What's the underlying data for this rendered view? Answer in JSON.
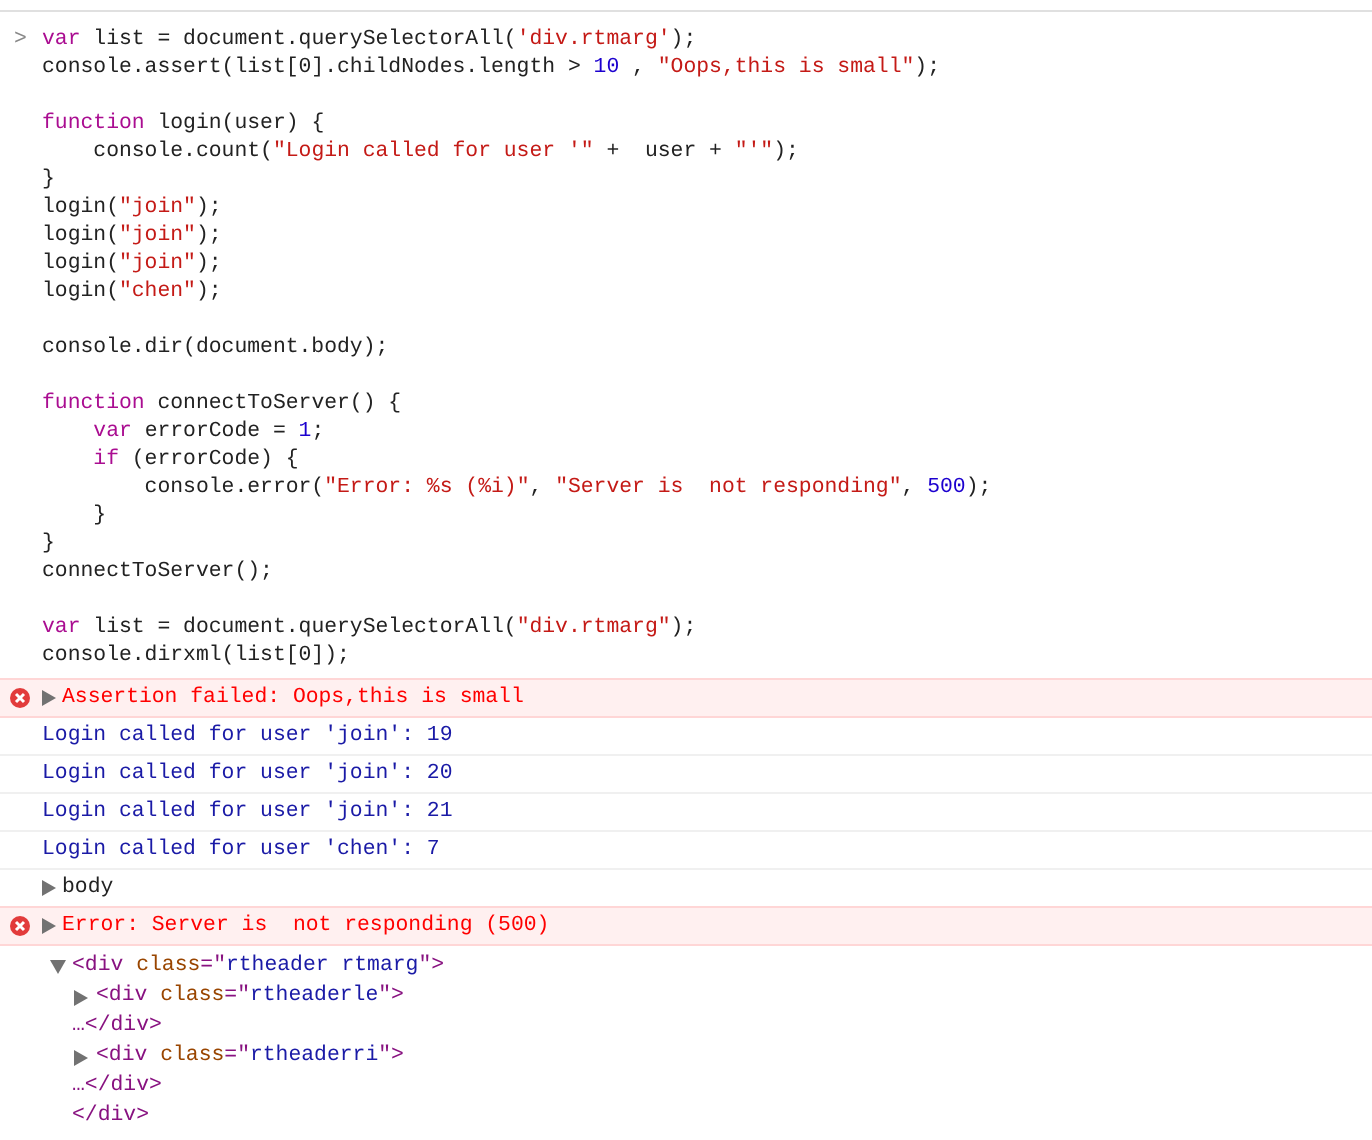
{
  "input": {
    "prompt": ">",
    "lines": [
      {
        "kind": "code",
        "tokens": [
          {
            "kind": "kw",
            "text": "var"
          },
          {
            "kind": "plain",
            "text": " list = document.querySelectorAll("
          },
          {
            "kind": "str",
            "text": "'div.rtmarg'"
          },
          {
            "kind": "plain",
            "text": ");"
          }
        ]
      },
      {
        "kind": "code",
        "tokens": [
          {
            "kind": "plain",
            "text": "console.assert(list[0].childNodes.length > "
          },
          {
            "kind": "num",
            "text": "10"
          },
          {
            "kind": "plain",
            "text": " , "
          },
          {
            "kind": "str",
            "text": "\"Oops,this is small\""
          },
          {
            "kind": "plain",
            "text": ");"
          }
        ]
      },
      {
        "kind": "blank"
      },
      {
        "kind": "code",
        "tokens": [
          {
            "kind": "kw",
            "text": "function"
          },
          {
            "kind": "plain",
            "text": " login(user) {"
          }
        ]
      },
      {
        "kind": "code",
        "tokens": [
          {
            "kind": "plain",
            "text": "    console.count("
          },
          {
            "kind": "str",
            "text": "\"Login called for user '\""
          },
          {
            "kind": "plain",
            "text": " +  user + "
          },
          {
            "kind": "str",
            "text": "\"'\""
          },
          {
            "kind": "plain",
            "text": ");"
          }
        ]
      },
      {
        "kind": "code",
        "tokens": [
          {
            "kind": "plain",
            "text": "}"
          }
        ]
      },
      {
        "kind": "code",
        "tokens": [
          {
            "kind": "plain",
            "text": "login("
          },
          {
            "kind": "str",
            "text": "\"join\""
          },
          {
            "kind": "plain",
            "text": ");"
          }
        ]
      },
      {
        "kind": "code",
        "tokens": [
          {
            "kind": "plain",
            "text": "login("
          },
          {
            "kind": "str",
            "text": "\"join\""
          },
          {
            "kind": "plain",
            "text": ");"
          }
        ]
      },
      {
        "kind": "code",
        "tokens": [
          {
            "kind": "plain",
            "text": "login("
          },
          {
            "kind": "str",
            "text": "\"join\""
          },
          {
            "kind": "plain",
            "text": ");"
          }
        ]
      },
      {
        "kind": "code",
        "tokens": [
          {
            "kind": "plain",
            "text": "login("
          },
          {
            "kind": "str",
            "text": "\"chen\""
          },
          {
            "kind": "plain",
            "text": ");"
          }
        ]
      },
      {
        "kind": "blank"
      },
      {
        "kind": "code",
        "tokens": [
          {
            "kind": "plain",
            "text": "console.dir(document.body);"
          }
        ]
      },
      {
        "kind": "blank"
      },
      {
        "kind": "code",
        "tokens": [
          {
            "kind": "kw",
            "text": "function"
          },
          {
            "kind": "plain",
            "text": " connectToServer() {"
          }
        ]
      },
      {
        "kind": "code",
        "tokens": [
          {
            "kind": "kw",
            "text": "    var"
          },
          {
            "kind": "plain",
            "text": " errorCode = "
          },
          {
            "kind": "num",
            "text": "1"
          },
          {
            "kind": "plain",
            "text": ";"
          }
        ]
      },
      {
        "kind": "code",
        "tokens": [
          {
            "kind": "kw",
            "text": "    if"
          },
          {
            "kind": "plain",
            "text": " (errorCode) {"
          }
        ]
      },
      {
        "kind": "code",
        "tokens": [
          {
            "kind": "plain",
            "text": "        console.error("
          },
          {
            "kind": "str",
            "text": "\"Error: %s (%i)\""
          },
          {
            "kind": "plain",
            "text": ", "
          },
          {
            "kind": "str",
            "text": "\"Server is  not responding\""
          },
          {
            "kind": "plain",
            "text": ", "
          },
          {
            "kind": "num",
            "text": "500"
          },
          {
            "kind": "plain",
            "text": ");"
          }
        ]
      },
      {
        "kind": "code",
        "tokens": [
          {
            "kind": "plain",
            "text": "    }"
          }
        ]
      },
      {
        "kind": "code",
        "tokens": [
          {
            "kind": "plain",
            "text": "}"
          }
        ]
      },
      {
        "kind": "code",
        "tokens": [
          {
            "kind": "plain",
            "text": "connectToServer();"
          }
        ]
      },
      {
        "kind": "blank"
      },
      {
        "kind": "code",
        "tokens": [
          {
            "kind": "kw",
            "text": "var"
          },
          {
            "kind": "plain",
            "text": " list = document.querySelectorAll("
          },
          {
            "kind": "str",
            "text": "\"div.rtmarg\""
          },
          {
            "kind": "plain",
            "text": ");"
          }
        ]
      },
      {
        "kind": "code",
        "tokens": [
          {
            "kind": "plain",
            "text": "console.dirxml(list[0]);"
          }
        ]
      }
    ]
  },
  "outputs": [
    {
      "kind": "error",
      "expanded": false,
      "text": "Assertion failed: Oops,this is small"
    },
    {
      "kind": "log",
      "text": "Login called for user 'join': 19"
    },
    {
      "kind": "log",
      "text": "Login called for user 'join': 20"
    },
    {
      "kind": "log",
      "text": "Login called for user 'join': 21"
    },
    {
      "kind": "log",
      "text": "Login called for user 'chen': 7"
    },
    {
      "kind": "object",
      "expanded": false,
      "text": "body"
    },
    {
      "kind": "error",
      "expanded": false,
      "text": "Error: Server is  not responding (500)"
    },
    {
      "kind": "dirxml",
      "tree": {
        "expanded": true,
        "tokens": [
          {
            "kind": "tag",
            "text": "<div "
          },
          {
            "kind": "attr",
            "text": "class"
          },
          {
            "kind": "tag",
            "text": "=\""
          },
          {
            "kind": "val",
            "text": "rtheader rtmarg"
          },
          {
            "kind": "tag",
            "text": "\">"
          }
        ],
        "close": [
          {
            "kind": "tag",
            "text": "</div>"
          }
        ],
        "children": [
          {
            "expanded": false,
            "tokens": [
              {
                "kind": "tag",
                "text": "<div "
              },
              {
                "kind": "attr",
                "text": "class"
              },
              {
                "kind": "tag",
                "text": "=\""
              },
              {
                "kind": "val",
                "text": "rtheaderle"
              },
              {
                "kind": "tag",
                "text": "\">"
              }
            ],
            "close": [
              {
                "kind": "tag",
                "text": "…</div>"
              }
            ]
          },
          {
            "expanded": false,
            "tokens": [
              {
                "kind": "tag",
                "text": "<div "
              },
              {
                "kind": "attr",
                "text": "class"
              },
              {
                "kind": "tag",
                "text": "=\""
              },
              {
                "kind": "val",
                "text": "rtheaderri"
              },
              {
                "kind": "tag",
                "text": "\">"
              }
            ],
            "close": [
              {
                "kind": "tag",
                "text": "…</div>"
              }
            ]
          }
        ]
      }
    }
  ]
}
